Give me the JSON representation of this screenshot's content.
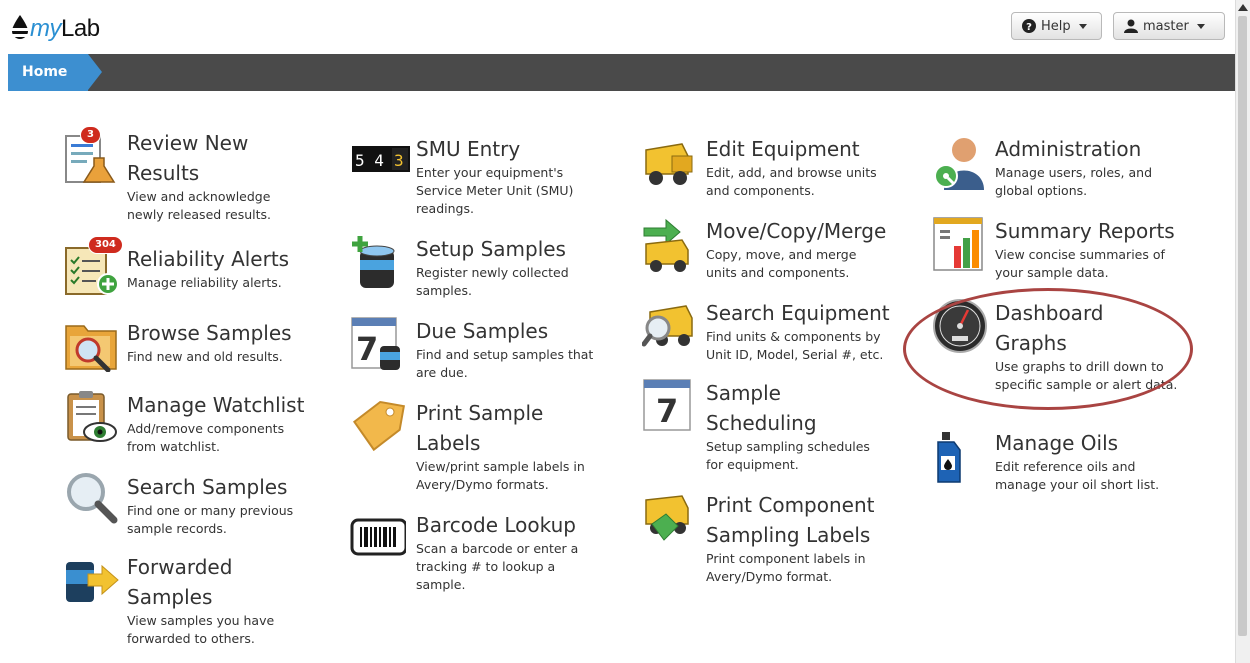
{
  "header": {
    "logo_prefix": "my",
    "logo_suffix": "Lab",
    "help_label": "Help",
    "user_label": "master"
  },
  "breadcrumb": {
    "home": "Home"
  },
  "tiles": {
    "review_new_results": {
      "title": "Review New Results",
      "desc": "View and acknowledge newly released results.",
      "badge": "3"
    },
    "reliability_alerts": {
      "title": "Reliability Alerts",
      "desc": "Manage reliability alerts.",
      "badge": "304"
    },
    "browse_samples": {
      "title": "Browse Samples",
      "desc": "Find new and old results."
    },
    "manage_watchlist": {
      "title": "Manage Watchlist",
      "desc": "Add/remove components from watchlist."
    },
    "search_samples": {
      "title": "Search Samples",
      "desc": "Find one or many previous sample records."
    },
    "forwarded_samples": {
      "title": "Forwarded Samples",
      "desc": "View samples you have forwarded to others."
    },
    "smu_entry": {
      "title": "SMU Entry",
      "desc": "Enter your equipment's Service Meter Unit (SMU) readings.",
      "icon_digits": "5 4"
    },
    "setup_samples": {
      "title": "Setup Samples",
      "desc": "Register newly collected samples."
    },
    "due_samples": {
      "title": "Due Samples",
      "desc": "Find and setup samples that are due.",
      "icon_day": "7"
    },
    "print_sample_labels": {
      "title": "Print Sample Labels",
      "desc": "View/print sample labels in Avery/Dymo formats."
    },
    "barcode_lookup": {
      "title": "Barcode Lookup",
      "desc": "Scan a barcode or enter a tracking # to lookup a sample."
    },
    "edit_equipment": {
      "title": "Edit Equipment",
      "desc": "Edit, add, and browse units and components."
    },
    "move_copy_merge": {
      "title": "Move/Copy/Merge",
      "desc": "Copy, move, and merge units and components."
    },
    "search_equipment": {
      "title": "Search Equipment",
      "desc": "Find units & components by Unit ID, Model, Serial #, etc."
    },
    "sample_scheduling": {
      "title": "Sample Scheduling",
      "desc": "Setup sampling schedules for equipment.",
      "icon_day": "7"
    },
    "print_component_labels": {
      "title": "Print Component Sampling Labels",
      "desc": "Print component labels in Avery/Dymo format."
    },
    "administration": {
      "title": "Administration",
      "desc": "Manage users, roles, and global options."
    },
    "summary_reports": {
      "title": "Summary Reports",
      "desc": "View concise summaries of your sample data."
    },
    "dashboard_graphs": {
      "title": "Dashboard Graphs",
      "desc": "Use graphs to drill down to specific sample or alert data."
    },
    "manage_oils": {
      "title": "Manage Oils",
      "desc": "Edit reference oils and manage your oil short list."
    }
  },
  "colors": {
    "accent": "#3d8fd0",
    "navbar": "#4a4a4a",
    "badge": "#cf2b1e",
    "highlight": "#a94442"
  }
}
